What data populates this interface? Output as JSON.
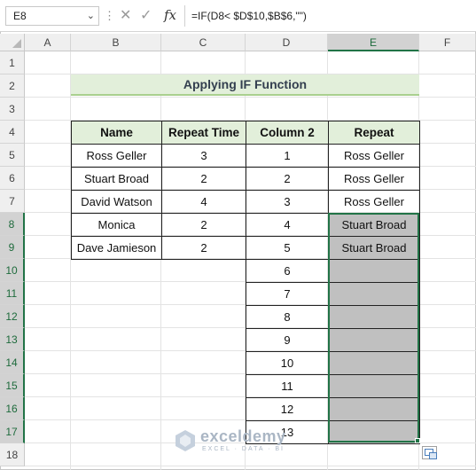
{
  "formula_bar": {
    "name_box": "E8",
    "formula": "=IF(D8< $D$10,$B$6,\"\")",
    "fx_label": "fx"
  },
  "columns": [
    "A",
    "B",
    "C",
    "D",
    "E",
    "F"
  ],
  "selected_column": "E",
  "rows": [
    "1",
    "2",
    "3",
    "4",
    "5",
    "6",
    "7",
    "8",
    "9",
    "10",
    "11",
    "12",
    "13",
    "14",
    "15",
    "16",
    "17",
    "18"
  ],
  "title": "Applying IF Function",
  "table1": {
    "headers": [
      "Name",
      "Repeat Time"
    ],
    "rows": [
      [
        "Ross Geller",
        "3"
      ],
      [
        "Stuart Broad",
        "2"
      ],
      [
        "David Watson",
        "4"
      ],
      [
        "Monica",
        "2"
      ],
      [
        "Dave Jamieson",
        "2"
      ]
    ]
  },
  "table2": {
    "headers": [
      "Column 2",
      "Repeat"
    ],
    "rows": [
      [
        "1",
        "Ross Geller"
      ],
      [
        "2",
        "Ross Geller"
      ],
      [
        "3",
        "Ross Geller"
      ],
      [
        "4",
        "Stuart Broad"
      ],
      [
        "5",
        "Stuart Broad"
      ],
      [
        "6",
        ""
      ],
      [
        "7",
        ""
      ],
      [
        "8",
        ""
      ],
      [
        "9",
        ""
      ],
      [
        "10",
        ""
      ],
      [
        "11",
        ""
      ],
      [
        "12",
        ""
      ],
      [
        "13",
        ""
      ]
    ]
  },
  "watermark": {
    "name": "exceldemy",
    "tagline": "EXCEL · DATA · BI"
  },
  "colors": {
    "header_fill": "#e2efda",
    "selection": "#217346",
    "gray_fill": "#c0c0c0"
  }
}
